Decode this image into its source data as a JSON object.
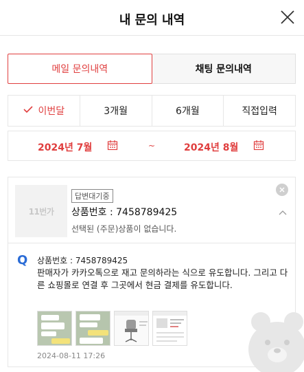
{
  "header": {
    "title": "내 문의 내역",
    "close_icon": "close-icon"
  },
  "tabs": [
    {
      "label": "메일 문의내역",
      "active": true
    },
    {
      "label": "채팅 문의내역",
      "active": false
    }
  ],
  "periods": [
    {
      "label": "이번달",
      "selected": true
    },
    {
      "label": "3개월",
      "selected": false
    },
    {
      "label": "6개월",
      "selected": false
    },
    {
      "label": "직접입력",
      "selected": false
    }
  ],
  "date_range": {
    "start": "2024년 7월",
    "separator": "~",
    "end": "2024년 8월"
  },
  "inquiry": {
    "thumbnail_logo": "11번가",
    "status_badge": "답변대기중",
    "product_no": "상품번호 : 7458789425",
    "product_message": "선택된 (주문)상품이 없습니다.",
    "q_label": "Q",
    "q_product_no": "상품번호 : 7458789425",
    "q_text": "판매자가 카카오톡으로 재고 문의하라는 식으로 유도합니다. 그리고 다른 쇼핑몰로 연결 후 그곳에서 현금 결제를 유도합니다.",
    "attachments": [
      "chat-screenshot-1",
      "chat-screenshot-2",
      "product-page-chair",
      "product-page-list"
    ],
    "date": "2024-08-11 17:26"
  },
  "colors": {
    "accent": "#e03e3e",
    "q_blue": "#2b6cd6",
    "border": "#e6e6e6"
  }
}
